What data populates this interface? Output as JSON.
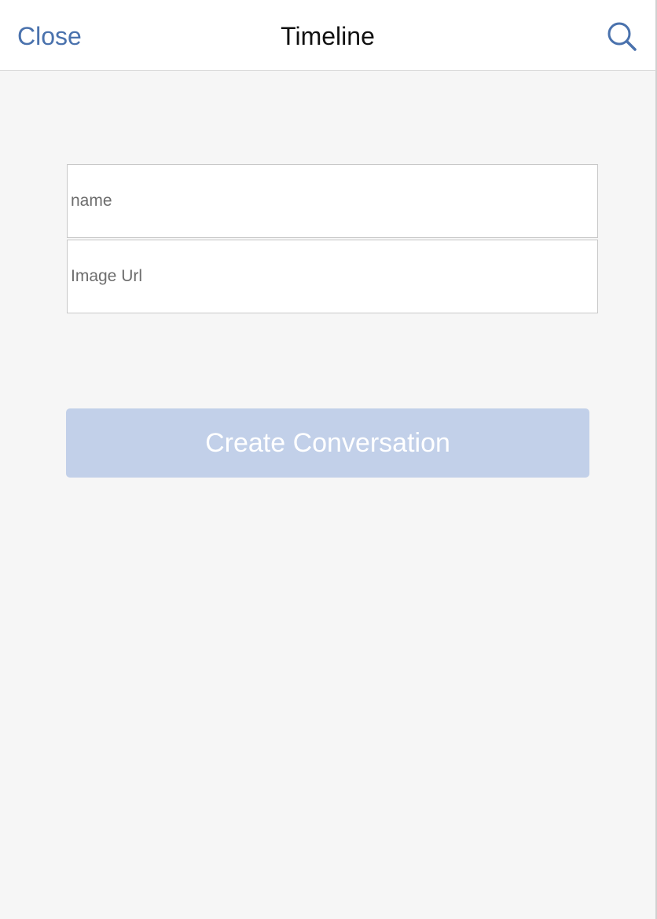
{
  "navbar": {
    "close_label": "Close",
    "title": "Timeline",
    "search_icon": "search-icon"
  },
  "form": {
    "name_placeholder": "name",
    "name_value": "",
    "image_url_placeholder": "Image Url",
    "image_url_value": "",
    "create_button_label": "Create Conversation",
    "create_button_enabled": false
  },
  "colors": {
    "accent": "#4a72ad",
    "button_disabled_bg": "#c2d0e9",
    "background": "#f6f6f6"
  }
}
